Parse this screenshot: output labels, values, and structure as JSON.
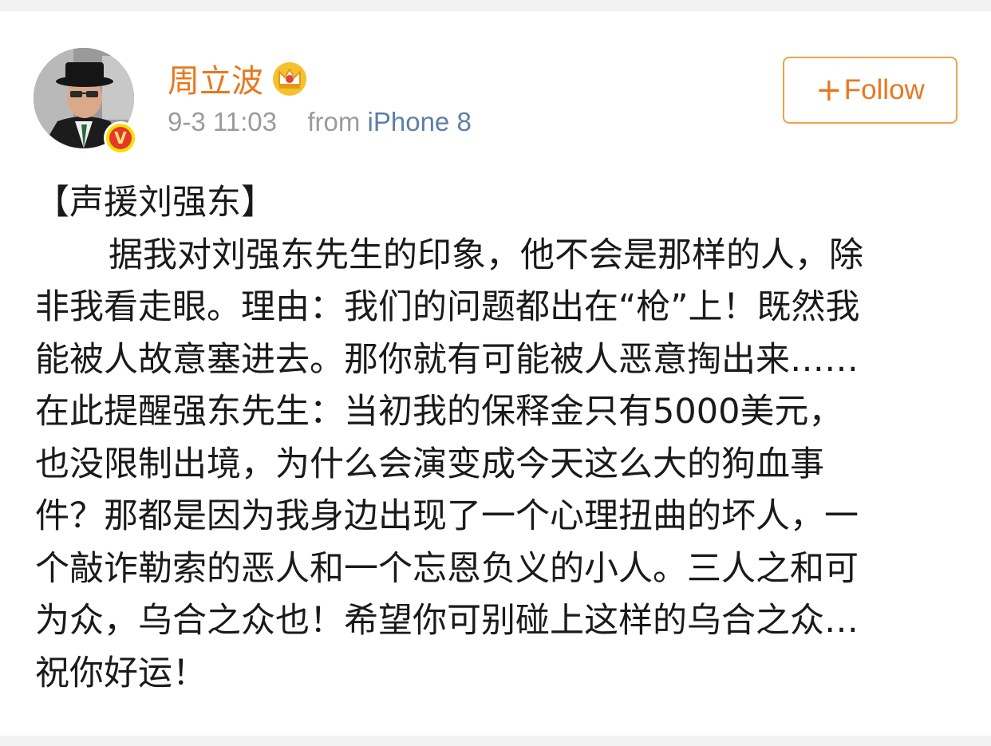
{
  "user": {
    "name": "周立波",
    "verified_badge": "V",
    "crown_icon": "vip-crown-icon"
  },
  "meta": {
    "time": "9-3 11:03",
    "from_label": "from",
    "source": "iPhone 8"
  },
  "follow": {
    "plus": "+",
    "label": "Follow"
  },
  "post": {
    "lines": [
      "【声援刘强东】",
      "据我对刘强东先生的印象，他不会是那样的人，除",
      "非我看走眼。理由：我们的问题都出在“枪”上！既然我",
      "能被人故意塞进去。那你就有可能被人恶意掏出来……",
      "在此提醒强东先生：当初我的保释金只有5000美元，",
      "也没限制出境，为什么会演变成今天这么大的狗血事",
      "件？那都是因为我身边出现了一个心理扭曲的坏人，一",
      "个敲诈勒索的恶人和一个忘恩负义的小人。三人之和可",
      "为众，乌合之众也！希望你可别碰上这样的乌合之众…",
      "祝你好运！"
    ]
  },
  "colors": {
    "username": "#e8781f",
    "follow_border": "#f0a14a",
    "meta_gray": "#9b9b9b",
    "source_blue": "#5c7fa8",
    "body_text": "#1a1a1a"
  }
}
